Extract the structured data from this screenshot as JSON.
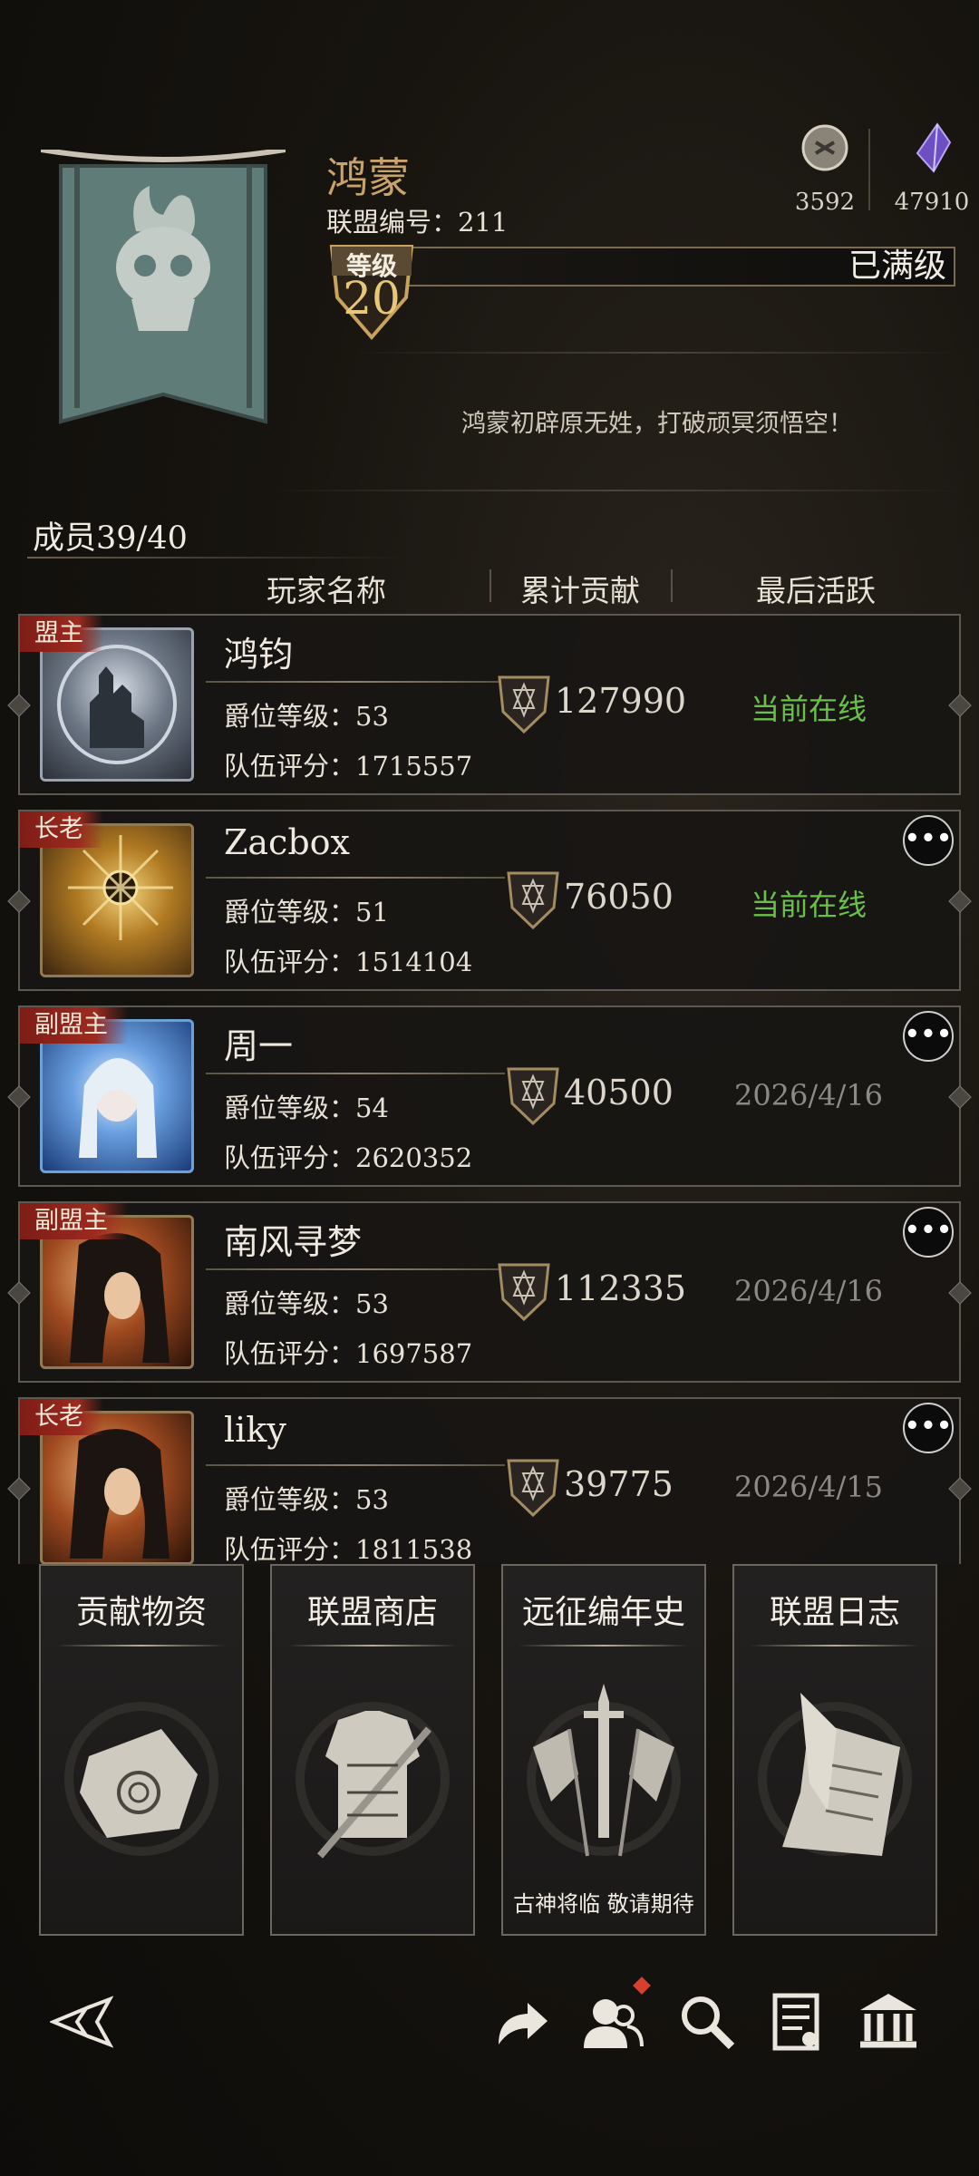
{
  "header": {
    "guild_name": "鸿蒙",
    "guild_id_label": "联盟编号：211",
    "level_word": "等级",
    "level": "20",
    "level_status": "已满级",
    "motto": "鸿蒙初辟原无姓，打破顽冥须悟空！",
    "currency": [
      {
        "icon": "coin-icon",
        "value": "3592"
      },
      {
        "icon": "crystal-icon",
        "value": "47910"
      }
    ]
  },
  "members": {
    "count_label": "成员39/40",
    "columns": [
      "玩家名称",
      "累计贡献",
      "最后活跃"
    ],
    "rows": [
      {
        "rank": "盟主",
        "name": "鸿钧",
        "title": "爵位等级：53",
        "score": "队伍评分：1715557",
        "contribution": "127990",
        "last_active": "当前在线",
        "online": true,
        "more": false
      },
      {
        "rank": "长老",
        "name": "Zacbox",
        "title": "爵位等级：51",
        "score": "队伍评分：1514104",
        "contribution": "76050",
        "last_active": "当前在线",
        "online": true,
        "more": true
      },
      {
        "rank": "副盟主",
        "name": "周一",
        "title": "爵位等级：54",
        "score": "队伍评分：2620352",
        "contribution": "40500",
        "last_active": "2026/4/16",
        "online": false,
        "more": true
      },
      {
        "rank": "副盟主",
        "name": "南风寻梦",
        "title": "爵位等级：53",
        "score": "队伍评分：1697587",
        "contribution": "112335",
        "last_active": "2026/4/16",
        "online": false,
        "more": true
      },
      {
        "rank": "长老",
        "name": "liky",
        "title": "爵位等级：53",
        "score": "队伍评分：1811538",
        "contribution": "39775",
        "last_active": "2026/4/15",
        "online": false,
        "more": true
      }
    ],
    "more_glyph": "•••"
  },
  "cards": [
    {
      "title": "贡献物资",
      "icon": "scroll-icon",
      "subtitle": ""
    },
    {
      "title": "联盟商店",
      "icon": "armor-icon",
      "subtitle": ""
    },
    {
      "title": "远征编年史",
      "icon": "sword-flags-icon",
      "subtitle": "古神将临 敬请期待"
    },
    {
      "title": "联盟日志",
      "icon": "quill-paper-icon",
      "subtitle": ""
    }
  ],
  "toolbar": [
    "back-icon",
    "share-icon",
    "members-icon",
    "search-icon",
    "document-icon",
    "hall-icon"
  ]
}
